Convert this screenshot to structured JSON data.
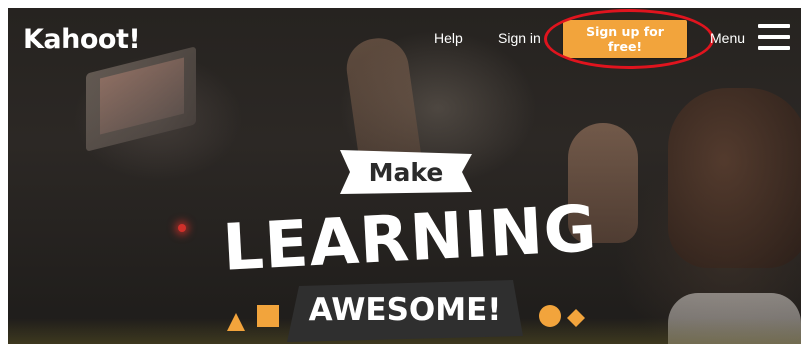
{
  "header": {
    "logo_text": "Kahoot!",
    "nav": {
      "help_label": "Help",
      "signin_label": "Sign in",
      "signup_label": "Sign up for free!",
      "menu_label": "Menu"
    }
  },
  "hero": {
    "line1": "Make",
    "line2": "LEARNING",
    "line3": "AWESOME!"
  },
  "colors": {
    "accent_orange": "#f2a43c",
    "annotation_red": "#e0141e",
    "banner_white": "#ffffff",
    "banner_dark": "#2d2d2d"
  },
  "icons": [
    "hamburger-menu-icon",
    "triangle-icon",
    "square-icon",
    "circle-icon",
    "diamond-icon"
  ]
}
